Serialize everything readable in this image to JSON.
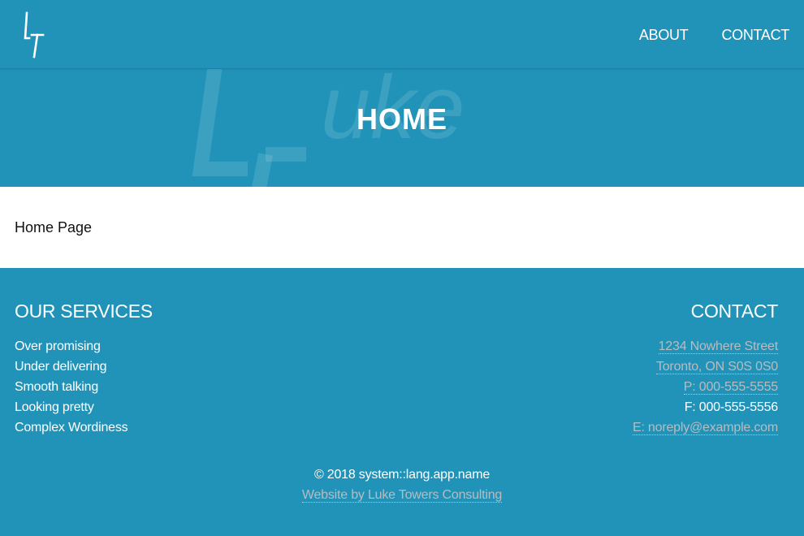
{
  "header": {
    "logo_icon": "lt-monogram-icon",
    "nav": [
      {
        "label": "ABOUT"
      },
      {
        "label": "CONTACT"
      }
    ]
  },
  "hero": {
    "watermark_text": "uke",
    "title": "HOME"
  },
  "content": {
    "text": "Home Page"
  },
  "footer": {
    "services": {
      "heading": "OUR SERVICES",
      "items": [
        "Over promising",
        "Under delivering",
        "Smooth talking",
        "Looking pretty",
        "Complex Wordiness"
      ]
    },
    "contact": {
      "heading": "CONTACT",
      "street": "1234 Nowhere Street",
      "city": "Toronto, ON S0S 0S0",
      "phone": "P: 000-555-5555",
      "fax": "F: 000-555-5556",
      "email": "E: noreply@example.com"
    },
    "copyright": "© 2018 system::lang.app.name",
    "credit": "Website by Luke Towers Consulting"
  },
  "colors": {
    "brand": "#2193b9",
    "link_muted": "#b8bcbf",
    "text_light": "#ffffff"
  }
}
